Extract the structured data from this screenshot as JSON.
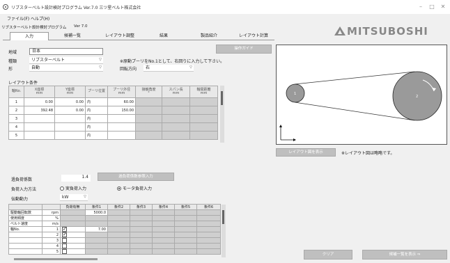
{
  "window": {
    "title": "リブスターベルト設計検討プログラム Ver.7.0  三ツ星ベルト株式会社",
    "controls": [
      "–",
      "□",
      "✕"
    ]
  },
  "menu": {
    "file": "ファイル(F)",
    "help": "ヘルプ(H)"
  },
  "subheader": {
    "program": "リブスターベルト設計検討プログラム",
    "version": "Ver 7.0"
  },
  "tabs": [
    {
      "label": "入力",
      "active": true
    },
    {
      "label": "候補一覧"
    },
    {
      "label": "レイアウト調整"
    },
    {
      "label": "結果"
    },
    {
      "label": "製品紹介"
    },
    {
      "label": "レイアウト計算"
    }
  ],
  "logo": "MITSUBOSHI",
  "guide_button": "操作ガイド",
  "form": {
    "region_label": "地域",
    "region_value": "日本",
    "type_label": "種類",
    "type_value": "リブスターベルト",
    "shape_label": "形",
    "shape_value": "自動",
    "note": "※原動プーリをNo.1として、右回りに入力して下さい。",
    "rotation_label": "回転方向",
    "rotation_value": "右"
  },
  "layout": {
    "title": "レイアウト条件",
    "headers": [
      "軸No.",
      "X座標\nmm",
      "Y座標\nmm",
      "プーリ位置",
      "プーリ外径\nmm",
      "接触角度\n°",
      "スパン長\nmm",
      "軸間距離\nmm"
    ],
    "rows": [
      {
        "no": "1",
        "x": "0.00",
        "y": "0.00",
        "pos": "内",
        "dia": "60.00"
      },
      {
        "no": "2",
        "x": "392.48",
        "y": "0.00",
        "pos": "内",
        "dia": "150.00"
      },
      {
        "no": "3",
        "x": "",
        "y": "",
        "pos": "内",
        "dia": ""
      },
      {
        "no": "4",
        "x": "",
        "y": "",
        "pos": "内",
        "dia": ""
      },
      {
        "no": "5",
        "x": "",
        "y": "",
        "pos": "内",
        "dia": ""
      }
    ]
  },
  "diagram": {
    "pulley1_label": "1",
    "pulley2_label": "2"
  },
  "show_layout_button": "レイアウト図を表示",
  "layout_note": "※レイアウト図は略略です。",
  "service": {
    "label": "過負荷係数",
    "value": "1.4",
    "button": "過負荷係数参照入力"
  },
  "load_input": {
    "label": "負荷入力方法",
    "option1": "実負荷入力",
    "option2": "モータ負荷入力"
  },
  "power": {
    "label": "伝動動力",
    "unit": "kW"
  },
  "conditions": {
    "headers": [
      "",
      "",
      "負荷有無",
      "条件1",
      "条件2",
      "条件3",
      "条件4",
      "条件5",
      "条件6"
    ],
    "rows": [
      {
        "label": "駆動軸回転数",
        "unit": "rpm",
        "c1": "5000.0"
      },
      {
        "label": "使用頻度",
        "unit": "%",
        "c1": ""
      },
      {
        "label": "ベルト速度",
        "unit": "m/s",
        "c1": ""
      },
      {
        "label": "軸No.",
        "unit": "1",
        "check": true,
        "c1": "7.00"
      },
      {
        "label": "",
        "unit": "2",
        "check": true,
        "c1": ""
      },
      {
        "label": "",
        "unit": "3",
        "check": false,
        "c1": ""
      },
      {
        "label": "",
        "unit": "4",
        "check": false,
        "c1": ""
      },
      {
        "label": "",
        "unit": "5",
        "check": false,
        "c1": ""
      }
    ]
  },
  "bottom": {
    "clear": "クリア",
    "show_candidates": "候補一覧を表示 ⇒"
  }
}
